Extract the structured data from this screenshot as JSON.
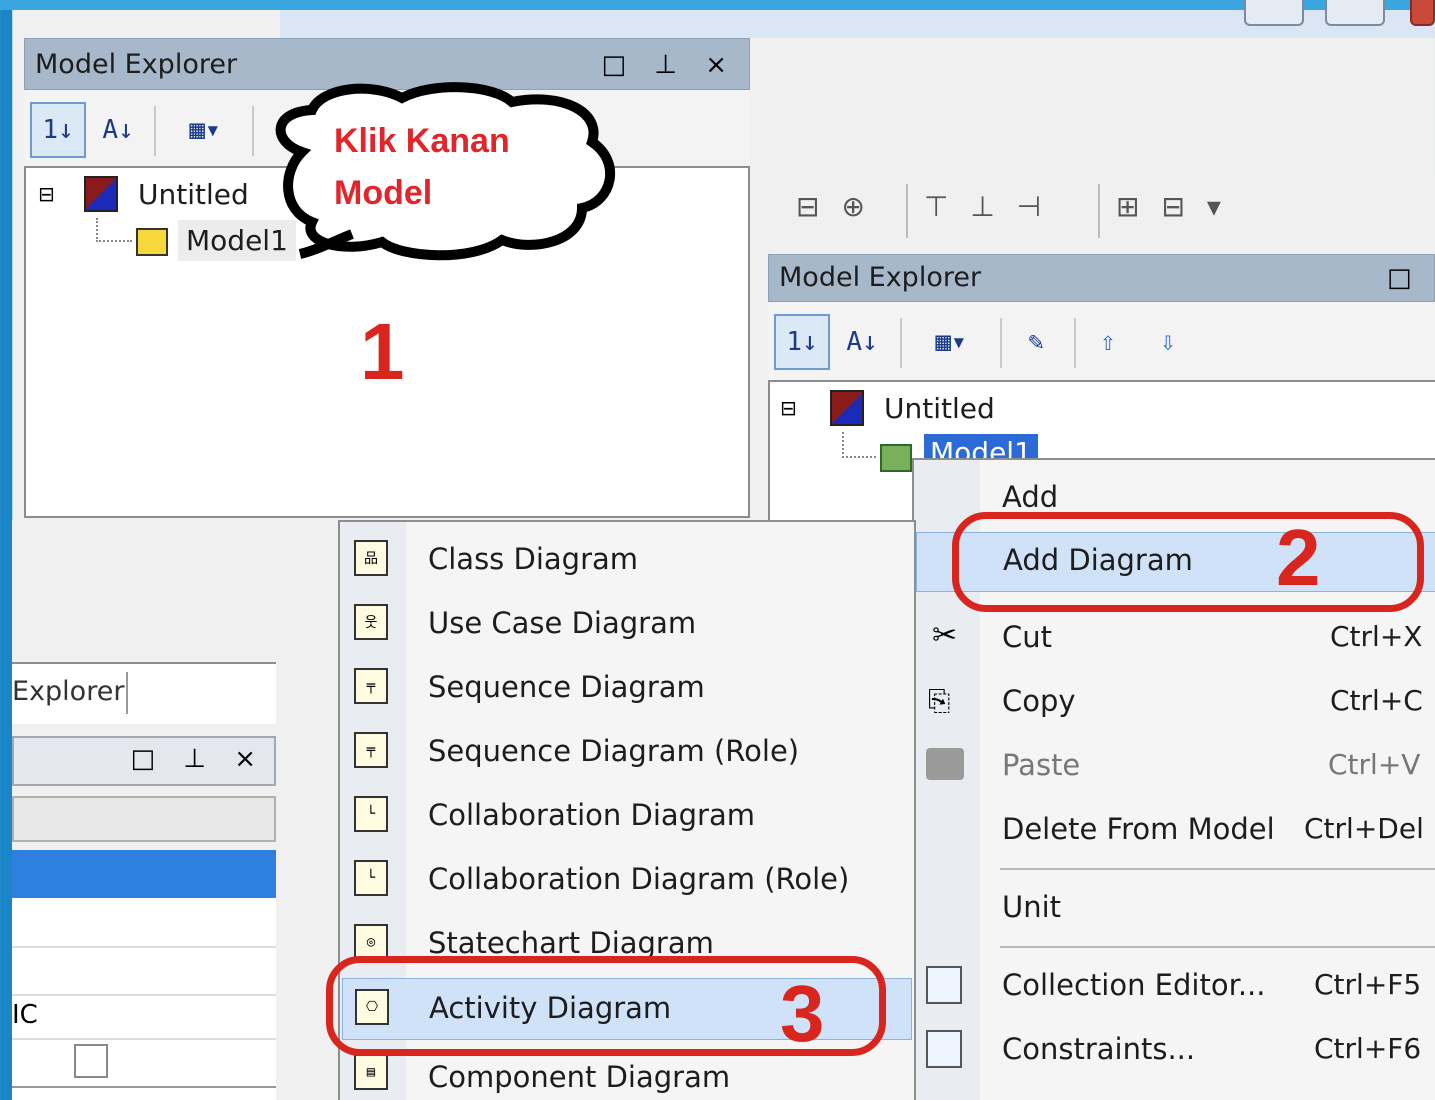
{
  "panel1": {
    "title": "Model Explorer",
    "controls": "□ ⊥ ×",
    "tree": {
      "root": "Untitled",
      "child": "Model1"
    },
    "step_number": "1"
  },
  "callout": {
    "line1": "Klik Kanan",
    "line2": "Model"
  },
  "panel2": {
    "title": "Model Explorer",
    "controls": "□",
    "tree": {
      "root": "Untitled",
      "child": "Model1"
    }
  },
  "left_panel": {
    "tab": "Explorer",
    "controls": "□ ⊥ ×",
    "row_text": "IC"
  },
  "context_menu": {
    "items": [
      {
        "label": "Add",
        "shortcut": ""
      },
      {
        "label": "Add Diagram",
        "shortcut": ""
      },
      {
        "label": "Cut",
        "shortcut": "Ctrl+X"
      },
      {
        "label": "Copy",
        "shortcut": "Ctrl+C"
      },
      {
        "label": "Paste",
        "shortcut": "Ctrl+V"
      },
      {
        "label": "Delete From Model",
        "shortcut": "Ctrl+Del"
      },
      {
        "label": "Unit",
        "shortcut": ""
      },
      {
        "label": "Collection Editor...",
        "shortcut": "Ctrl+F5"
      },
      {
        "label": "Constraints...",
        "shortcut": "Ctrl+F6"
      }
    ],
    "step_number": "2"
  },
  "diagram_submenu": {
    "items": [
      "Class Diagram",
      "Use Case Diagram",
      "Sequence Diagram",
      "Sequence Diagram (Role)",
      "Collaboration Diagram",
      "Collaboration Diagram (Role)",
      "Statechart Diagram",
      "Activity Diagram",
      "Component Diagram"
    ],
    "step_number": "3"
  },
  "colors": {
    "highlight": "#cfe2f7",
    "annotation_red": "#d8261f",
    "title_bar": "#a7b8cb"
  }
}
